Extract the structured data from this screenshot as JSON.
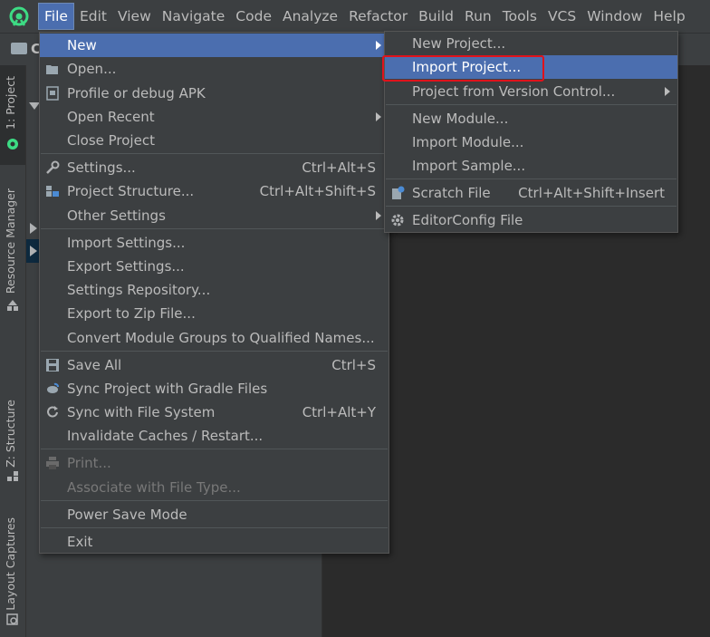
{
  "menubar": {
    "items": [
      "File",
      "Edit",
      "View",
      "Navigate",
      "Code",
      "Analyze",
      "Refactor",
      "Build",
      "Run",
      "Tools",
      "VCS",
      "Window",
      "Help"
    ],
    "active": "File"
  },
  "toolbar": {
    "crumb": "C"
  },
  "side_tabs": {
    "project": "1: Project",
    "resource_manager": "Resource Manager",
    "structure": "Z: Structure",
    "layout_captures": "Layout Captures"
  },
  "file_menu": {
    "new": "New",
    "open": "Open...",
    "profile": "Profile or debug APK",
    "open_recent": "Open Recent",
    "close_project": "Close Project",
    "settings": "Settings...",
    "settings_sc": "Ctrl+Alt+S",
    "project_structure": "Project Structure...",
    "project_structure_sc": "Ctrl+Alt+Shift+S",
    "other_settings": "Other Settings",
    "import_settings": "Import Settings...",
    "export_settings": "Export Settings...",
    "settings_repo": "Settings Repository...",
    "export_zip": "Export to Zip File...",
    "convert_groups": "Convert Module Groups to Qualified Names...",
    "save_all": "Save All",
    "save_all_sc": "Ctrl+S",
    "sync_gradle": "Sync Project with Gradle Files",
    "sync_fs": "Sync with File System",
    "sync_fs_sc": "Ctrl+Alt+Y",
    "invalidate": "Invalidate Caches / Restart...",
    "print": "Print...",
    "associate": "Associate with File Type...",
    "power_save": "Power Save Mode",
    "exit": "Exit"
  },
  "new_menu": {
    "new_project": "New Project...",
    "import_project": "Import Project...",
    "from_vcs": "Project from Version Control...",
    "new_module": "New Module...",
    "import_module": "Import Module...",
    "import_sample": "Import Sample...",
    "scratch_file": "Scratch File",
    "scratch_file_sc": "Ctrl+Alt+Shift+Insert",
    "editorconfig": "EditorConfig File"
  },
  "colors": {
    "menu_bg": "#3c3f41",
    "highlight": "#4b6eaf",
    "annotation_red": "#e0121b",
    "android_green": "#3ddc84"
  }
}
